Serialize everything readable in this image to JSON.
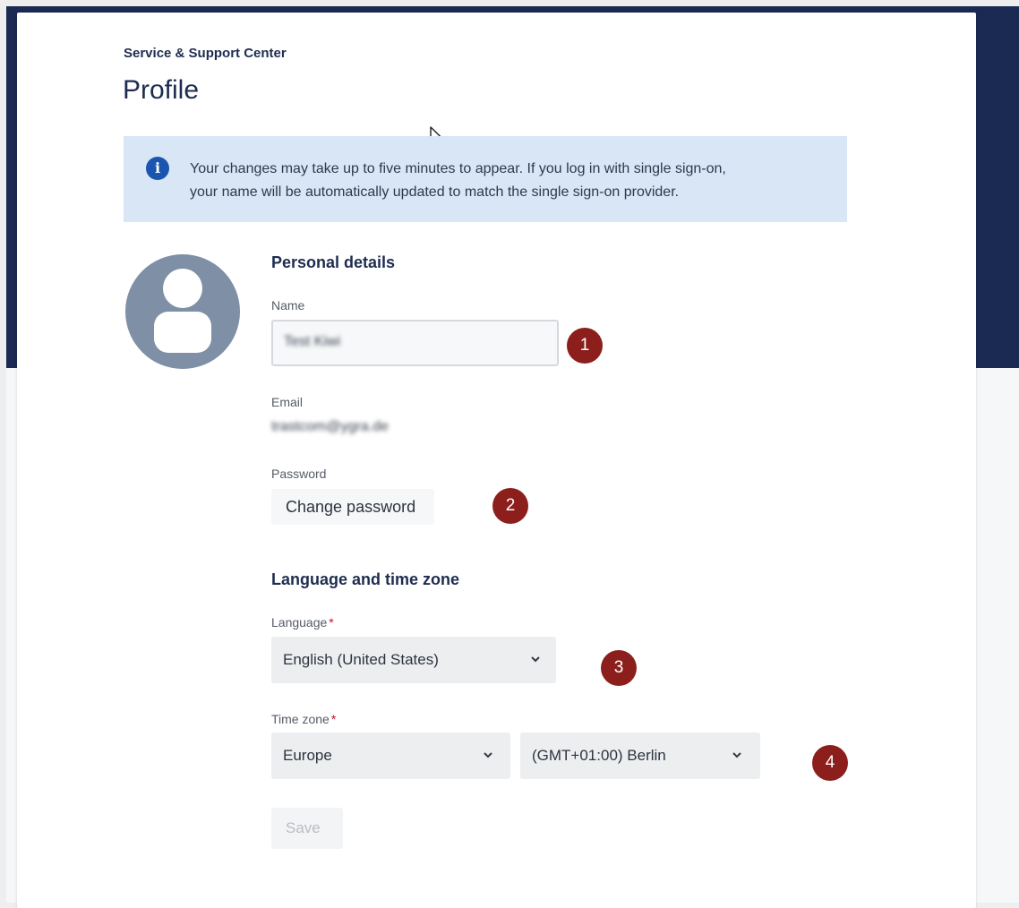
{
  "header": {
    "breadcrumb": "Service & Support Center",
    "title": "Profile"
  },
  "info_banner": {
    "text_line1": "Your changes may take up to five minutes to appear. If you log in with single sign-on,",
    "text_line2": "your name will be automatically updated to match the single sign-on provider."
  },
  "personal_details": {
    "heading": "Personal details",
    "name_label": "Name",
    "name_value": "Test Kiwi",
    "email_label": "Email",
    "email_value": "trastcom@ygra.de",
    "password_label": "Password",
    "change_password_label": "Change password"
  },
  "language_time_zone": {
    "heading": "Language and time zone",
    "language_label": "Language",
    "language_value": "English (United States)",
    "timezone_label": "Time zone",
    "region_value": "Europe",
    "zone_value": "(GMT+01:00) Berlin",
    "required_marker": "*"
  },
  "actions": {
    "save_label": "Save"
  },
  "callouts": [
    "1",
    "2",
    "3",
    "4"
  ],
  "colors": {
    "header_background": "#1b2a52",
    "banner_background": "#d9e6f5",
    "info_icon": "#1a56b0",
    "callout_badge": "#8c1f1c",
    "required_marker": "#c8102e"
  },
  "icons": {
    "info": "info-icon",
    "avatar": "user-avatar-icon",
    "dropdown": "chevron-down-icon",
    "cursor": "mouse-cursor-icon"
  }
}
